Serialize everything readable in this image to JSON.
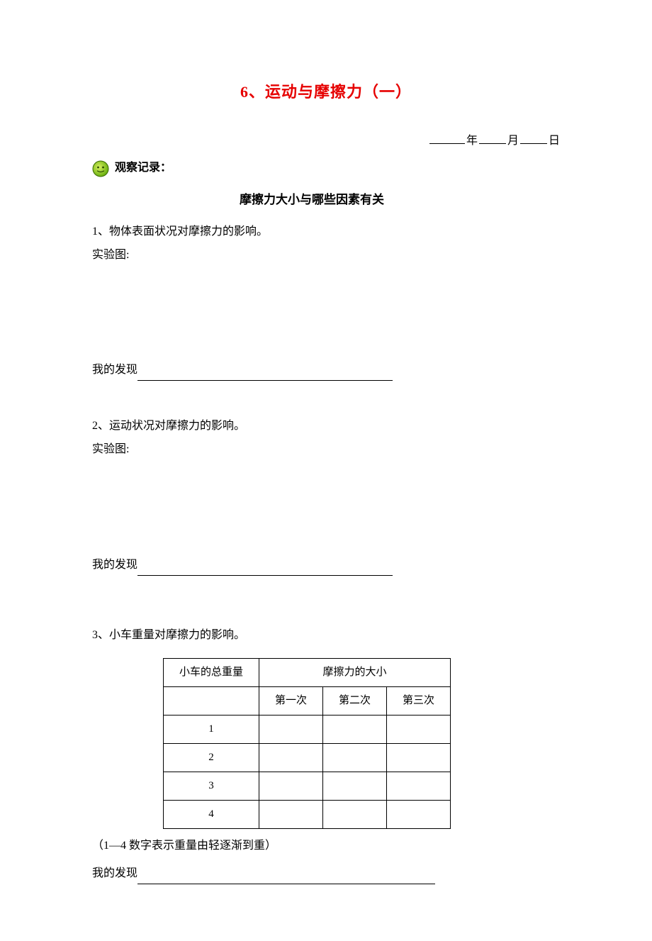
{
  "title": "6、运动与摩擦力（一）",
  "date": {
    "year_suffix": "年",
    "month_suffix": "月",
    "day_suffix": "日"
  },
  "record_label": "观察记录：",
  "subtitle": "摩擦力大小与哪些因素有关",
  "sections": {
    "s1": {
      "heading": "1、物体表面状况对摩擦力的影响。",
      "diagram_label": "实验图:",
      "finding_prefix": "我的发现"
    },
    "s2": {
      "heading": "2、运动状况对摩擦力的影响。",
      "diagram_label": "实验图:",
      "finding_prefix": "我的发现"
    },
    "s3": {
      "heading": "3、小车重量对摩擦力的影响。",
      "note": "（1—4 数字表示重量由轻逐渐到重）",
      "finding_prefix": "我的发现"
    }
  },
  "table": {
    "header_weight": "小车的总重量",
    "header_friction": "摩擦力的大小",
    "sub1": "第一次",
    "sub2": "第二次",
    "sub3": "第三次",
    "rows": [
      "1",
      "2",
      "3",
      "4"
    ]
  }
}
